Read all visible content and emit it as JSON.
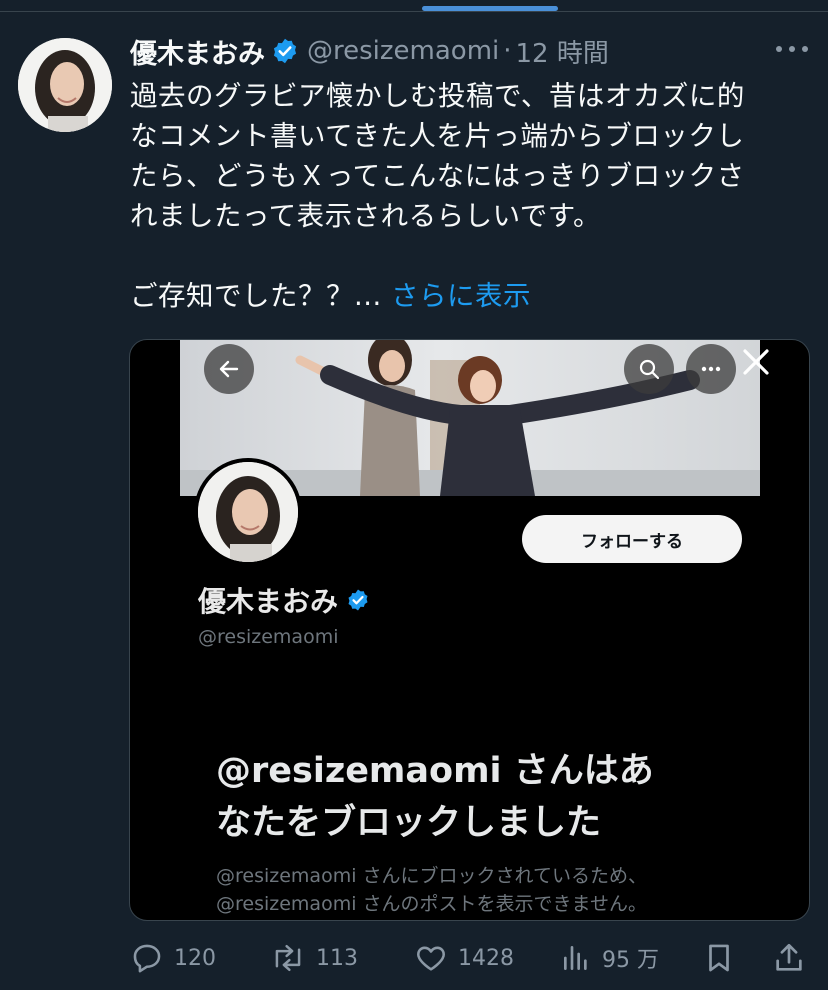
{
  "tweet": {
    "author": {
      "display_name": "優木まおみ",
      "handle": "@resizemaomi",
      "separator": "·",
      "time": "12 時間"
    },
    "text_lines": [
      "過去のグラビア懐かしむ投稿で、昔はオカズに的",
      "なコメント書いてきた人を片っ端からブロックし",
      "たら、どうもＸってこんなにはっきりブロックさ",
      "れましたって表示されるらしいです。"
    ],
    "text_last": "ご存知でした？？...",
    "show_more": "さらに表示"
  },
  "media": {
    "profile_name": "優木まおみ",
    "profile_handle": "@resizemaomi",
    "follow_label": "フォローする",
    "blocked_title_lines": [
      "@resizemaomi さんはあ",
      "なたをブロックしました"
    ],
    "blocked_sub_lines": [
      "@resizemaomi さんにブロックされているため、",
      "@resizemaomi さんのポストを表示できません。"
    ]
  },
  "actions": {
    "replies": "120",
    "reposts": "113",
    "likes": "1428",
    "views": "95 万"
  },
  "colors": {
    "background": "#15202b",
    "link": "#1d9bf0",
    "verified": "#1d9bf0",
    "muted": "#8b98a5"
  }
}
